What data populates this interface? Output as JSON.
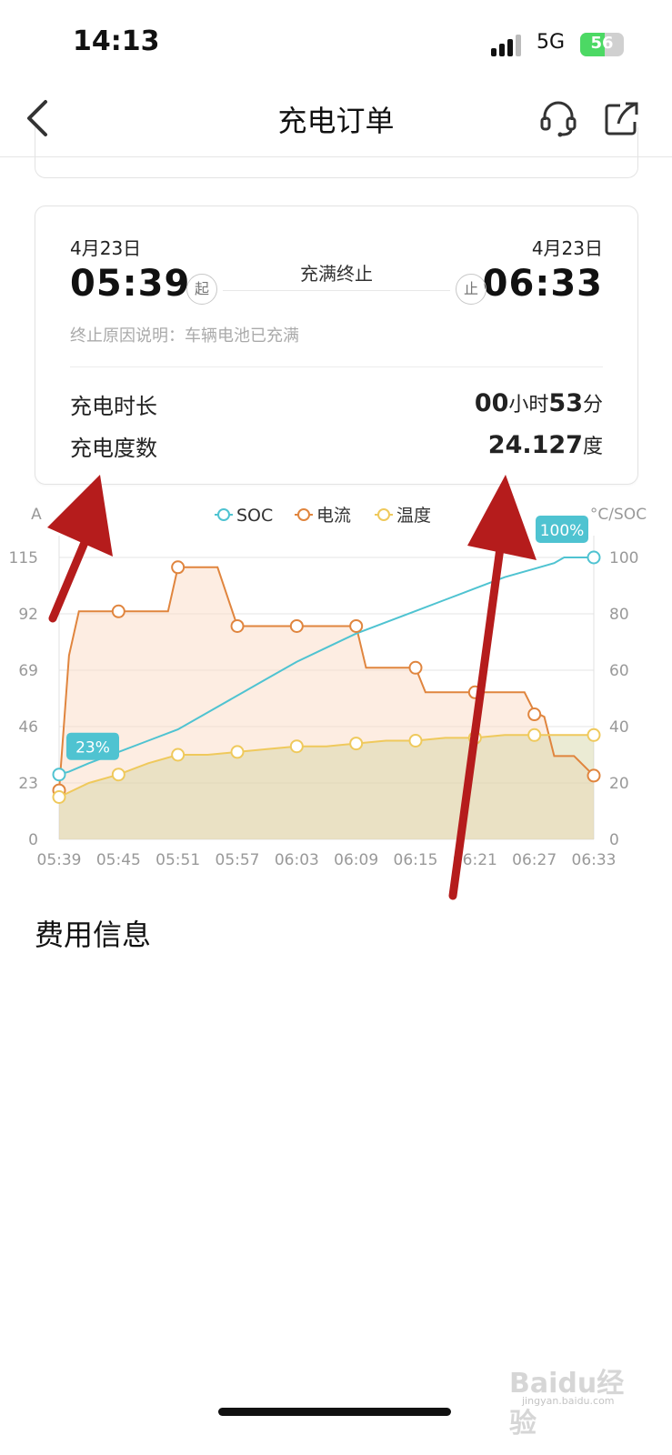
{
  "status": {
    "time": "14:13",
    "network": "5G",
    "battery": "56",
    "battery_level": 0.56
  },
  "nav": {
    "title": "充电订单",
    "back_icon": "chevron-left-icon",
    "support_icon": "headset-icon",
    "share_icon": "share-icon"
  },
  "order": {
    "start_date": "4月23日",
    "start_time": "05:39",
    "start_marker": "起",
    "end_date": "4月23日",
    "end_time": "06:33",
    "end_marker": "止",
    "stop_status": "充满终止",
    "stop_reason": "终止原因说明：车辆电池已充满",
    "duration_label": "充电时长",
    "duration_hours": "00",
    "duration_hours_unit": "小时",
    "duration_minutes": "53",
    "duration_minutes_unit": "分",
    "energy_label": "充电度数",
    "energy_value": "24.127",
    "energy_unit": "度"
  },
  "chart_data": {
    "type": "line",
    "left_axis_label": "A",
    "right_axis_label": "°C/SOC",
    "left_ticks": [
      "0",
      "23",
      "46",
      "69",
      "92",
      "115"
    ],
    "right_ticks": [
      "0",
      "20",
      "40",
      "60",
      "80",
      "100"
    ],
    "left_ylim": [
      0,
      115
    ],
    "right_ylim": [
      0,
      100
    ],
    "x_labels": [
      "05:39",
      "05:45",
      "05:51",
      "05:57",
      "06:03",
      "06:09",
      "06:15",
      "06:21",
      "06:27",
      "06:33"
    ],
    "legend": [
      "SOC",
      "电流",
      "温度"
    ],
    "legend_position": "top-center",
    "grid": true,
    "colors": {
      "soc": "#4fc3d1",
      "current": "#e0853e",
      "temperature": "#efc95c"
    },
    "series": [
      {
        "name": "SOC",
        "axis": "right",
        "x": [
          "05:39",
          "05:40",
          "05:42",
          "05:45",
          "05:48",
          "05:51",
          "05:54",
          "05:57",
          "06:00",
          "06:03",
          "06:06",
          "06:09",
          "06:12",
          "06:15",
          "06:18",
          "06:21",
          "06:24",
          "06:27",
          "06:29",
          "06:30",
          "06:33"
        ],
        "values": [
          23,
          24,
          27,
          31,
          35,
          39,
          45,
          51,
          57,
          63,
          68,
          73,
          77,
          81,
          85,
          89,
          93,
          96,
          98,
          100,
          100
        ]
      },
      {
        "name": "电流",
        "axis": "left",
        "x": [
          "05:39",
          "05:40",
          "05:41",
          "05:45",
          "05:50",
          "05:51",
          "05:55",
          "05:57",
          "06:03",
          "06:09",
          "06:10",
          "06:15",
          "06:16",
          "06:21",
          "06:26",
          "06:27",
          "06:28",
          "06:29",
          "06:31",
          "06:33"
        ],
        "values": [
          20,
          75,
          93,
          93,
          93,
          111,
          111,
          87,
          87,
          87,
          70,
          70,
          60,
          60,
          60,
          52,
          50,
          34,
          34,
          26
        ]
      },
      {
        "name": "温度",
        "axis": "right",
        "x": [
          "05:39",
          "05:42",
          "05:45",
          "05:48",
          "05:51",
          "05:54",
          "05:57",
          "06:00",
          "06:03",
          "06:06",
          "06:09",
          "06:12",
          "06:15",
          "06:18",
          "06:21",
          "06:24",
          "06:27",
          "06:30",
          "06:33"
        ],
        "values": [
          15,
          20,
          23,
          27,
          30,
          30,
          31,
          32,
          33,
          33,
          34,
          35,
          35,
          36,
          36,
          37,
          37,
          37,
          37
        ]
      }
    ],
    "markers": {
      "SOC": [
        {
          "x": "05:39",
          "y": 23
        },
        {
          "x": "06:33",
          "y": 100
        }
      ],
      "电流": [
        {
          "x": "05:39",
          "y": 20
        },
        {
          "x": "05:45",
          "y": 93
        },
        {
          "x": "05:51",
          "y": 111
        },
        {
          "x": "05:57",
          "y": 87
        },
        {
          "x": "06:03",
          "y": 87
        },
        {
          "x": "06:09",
          "y": 87
        },
        {
          "x": "06:15",
          "y": 70
        },
        {
          "x": "06:21",
          "y": 60
        },
        {
          "x": "06:27",
          "y": 51
        },
        {
          "x": "06:33",
          "y": 26
        }
      ],
      "温度": [
        {
          "x": "05:39",
          "y": 15
        },
        {
          "x": "05:45",
          "y": 23
        },
        {
          "x": "05:51",
          "y": 30
        },
        {
          "x": "05:57",
          "y": 31
        },
        {
          "x": "06:03",
          "y": 33
        },
        {
          "x": "06:09",
          "y": 34
        },
        {
          "x": "06:15",
          "y": 35
        },
        {
          "x": "06:21",
          "y": 36
        },
        {
          "x": "06:27",
          "y": 37
        },
        {
          "x": "06:33",
          "y": 37
        }
      ]
    },
    "soc_start_tag": "23%",
    "soc_end_tag": "100%"
  },
  "fee": {
    "title": "费用信息"
  },
  "watermark": {
    "brand": "Baidu经验",
    "domain": "jingyan.baidu.com"
  }
}
